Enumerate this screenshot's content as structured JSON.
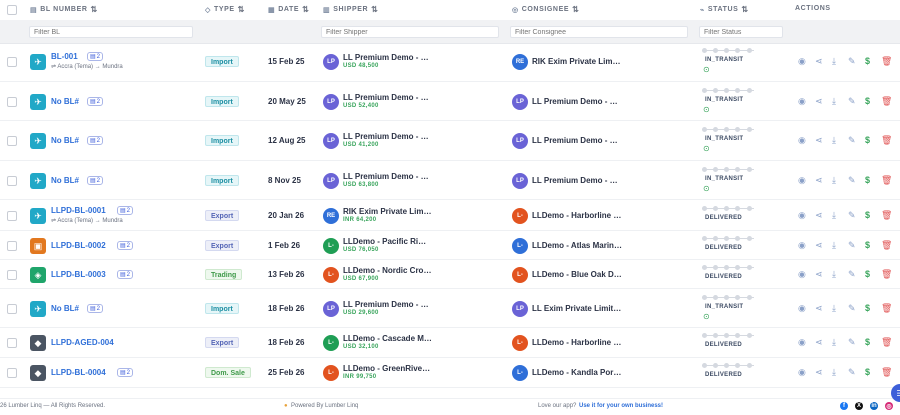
{
  "header": {
    "columns": {
      "bl_number": "BL NUMBER",
      "type": "TYPE",
      "date": "DATE",
      "shipper": "SHIPPER",
      "consignee": "CONSIGNEE",
      "status": "STATUS",
      "actions": "ACTIONS"
    },
    "sort_glyph": "⇅"
  },
  "filters": {
    "bl_placeholder": "Filter BL",
    "shipper_placeholder": "Filter Shipper",
    "consignee_placeholder": "Filter Consignee",
    "status_placeholder": "Filter Status"
  },
  "colors": {
    "accent": "#2f6fd8",
    "purple_avatar": "#6a63d6",
    "blue_avatar": "#2f6fd8",
    "orange_avatar": "#e2531f",
    "green_avatar": "#1f9e55",
    "success": "#3aa55d",
    "danger": "#e05252"
  },
  "rows": [
    {
      "bl": "BL-001",
      "docs": "2",
      "route_from": "Accra (Tema)",
      "route_to": "Mundra",
      "type": "Import",
      "date": "15 Feb 25",
      "shipper_initials": "LP",
      "shipper": "LL Premium Demo - Casc…",
      "amount": "USD 48,500",
      "consignee_initials": "RE",
      "consignee": "RIK Exim Private Limited",
      "status": "IN_TRANSIT",
      "icon": "plane-icon"
    },
    {
      "bl": "No BL#",
      "docs": "2",
      "type": "Import",
      "date": "20 May 25",
      "shipper_initials": "LP",
      "shipper": "LL Premium Demo - Casc…",
      "amount": "USD 52,400",
      "consignee_initials": "LP",
      "consignee": "LL Premium Demo - Casc…",
      "status": "IN_TRANSIT",
      "icon": "plane-icon"
    },
    {
      "bl": "No BL#",
      "docs": "2",
      "type": "Import",
      "date": "12 Aug 25",
      "shipper_initials": "LP",
      "shipper": "LL Premium Demo - Casc…",
      "amount": "USD 41,200",
      "consignee_initials": "LP",
      "consignee": "LL Premium Demo - Casc…",
      "status": "IN_TRANSIT",
      "icon": "plane-icon"
    },
    {
      "bl": "No BL#",
      "docs": "2",
      "type": "Import",
      "date": "8 Nov 25",
      "shipper_initials": "LP",
      "shipper": "LL Premium Demo - Casc…",
      "amount": "USD 63,800",
      "consignee_initials": "LP",
      "consignee": "LL Premium Demo - Casc…",
      "status": "IN_TRANSIT",
      "icon": "plane-icon"
    },
    {
      "bl": "LLPD-BL-0001",
      "docs": "2",
      "route_from": "Accra (Tema)",
      "route_to": "Mundra",
      "type": "Export",
      "date": "20 Jan 26",
      "shipper_initials": "RE",
      "shipper": "RIK Exim Private Limited",
      "amount": "INR 64,200",
      "consignee_initials": "L-",
      "consignee": "LLDemo - Harborline Buil…",
      "status": "DELIVERED",
      "icon": "plane-icon"
    },
    {
      "bl": "LLPD-BL-0002",
      "docs": "2",
      "type": "Export",
      "date": "1 Feb 26",
      "shipper_initials": "L-",
      "shipper": "LLDemo - Pacific Rim Har…",
      "amount": "USD 76,050",
      "consignee_initials": "L-",
      "consignee": "LLDemo - Atlas Marine Ti…",
      "status": "DELIVERED",
      "icon": "truck-icon"
    },
    {
      "bl": "LLPD-BL-0003",
      "docs": "2",
      "type": "Trading",
      "date": "13 Feb 26",
      "shipper_initials": "L-",
      "shipper": "LLDemo - Nordic Crown F…",
      "amount": "USD 67,900",
      "consignee_initials": "L-",
      "consignee": "LLDemo - Blue Oak Distri…",
      "status": "DELIVERED",
      "icon": "ship-icon"
    },
    {
      "bl": "No BL#",
      "docs": "2",
      "type": "Import",
      "date": "18 Feb 26",
      "shipper_initials": "LP",
      "shipper": "LL Premium Demo - Casc…",
      "amount": "USD 29,600",
      "consignee_initials": "LP",
      "consignee": "LL Exim Private Limited",
      "status": "IN_TRANSIT",
      "icon": "plane-icon"
    },
    {
      "bl": "LLPD-AGED-004",
      "type": "Export",
      "date": "18 Feb 26",
      "shipper_initials": "L-",
      "shipper": "LLDemo - Cascade Meridi…",
      "amount": "USD 32,100",
      "consignee_initials": "L-",
      "consignee": "LLDemo - Harborline Buil…",
      "status": "DELIVERED",
      "icon": "box-icon"
    },
    {
      "bl": "LLPD-BL-0004",
      "docs": "2",
      "type": "Dom. Sale",
      "date": "25 Feb 26",
      "shipper_initials": "L-",
      "shipper": "LLDemo - GreenRiver Sus…",
      "amount": "INR 99,750",
      "consignee_initials": "L-",
      "consignee": "LLDemo - Kandla Port Lo…",
      "status": "DELIVERED",
      "icon": "box-icon"
    }
  ],
  "footer": {
    "copyright": "26 Lumber Linq — All Rights Reserved.",
    "powered": "Powered By Lumber Linq",
    "love": "Love our app?",
    "cta": "Use it for your own business!"
  }
}
